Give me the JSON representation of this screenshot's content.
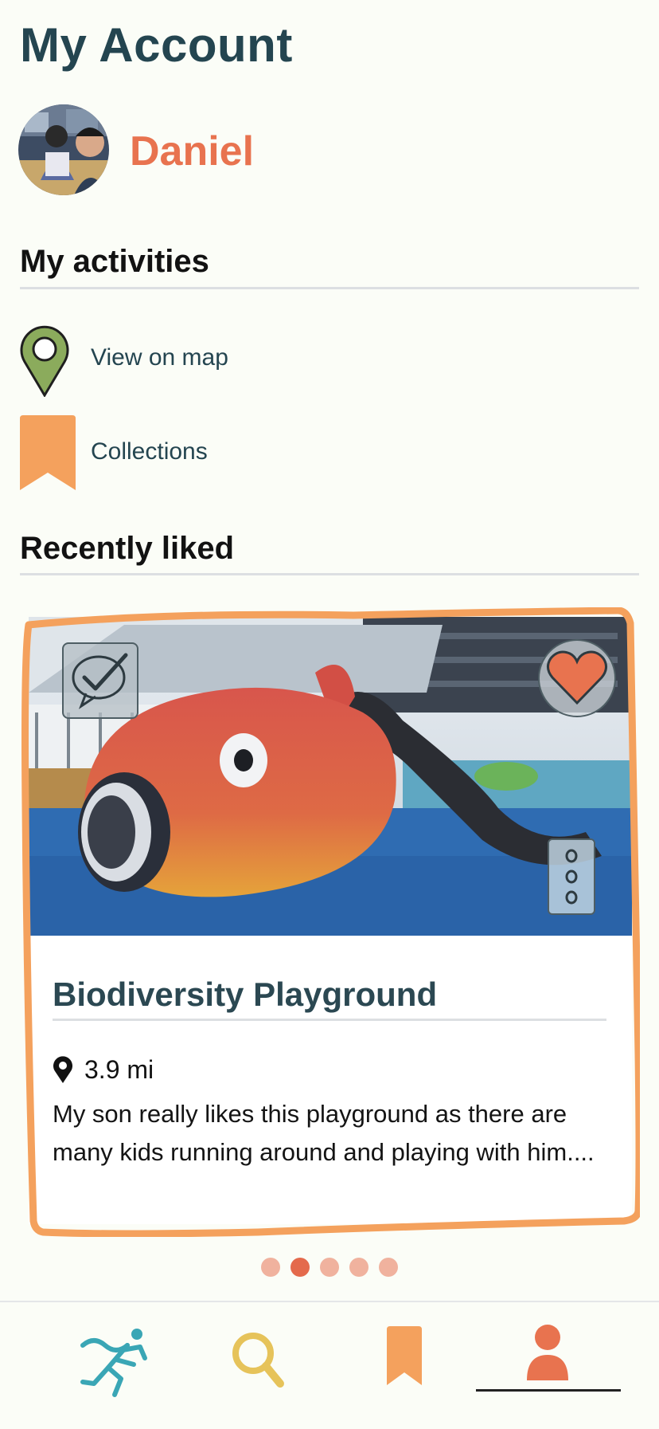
{
  "header": {
    "title": "My Account"
  },
  "profile": {
    "username": "Daniel"
  },
  "activities": {
    "heading": "My activities",
    "items": [
      {
        "label": "View on map",
        "icon": "map-pin-icon"
      },
      {
        "label": "Collections",
        "icon": "bookmark-icon"
      }
    ]
  },
  "recently_liked": {
    "heading": "Recently liked",
    "card": {
      "title": "Biodiversity Playground",
      "distance": "3.9 mi",
      "description": "My son really likes this playground as there are many kids running around and playing with him....",
      "liked": true
    },
    "pagination": {
      "total": 5,
      "active_index": 1
    }
  },
  "bottom_nav": {
    "items": [
      {
        "name": "activities",
        "icon": "running-person-icon"
      },
      {
        "name": "search",
        "icon": "search-icon"
      },
      {
        "name": "saved",
        "icon": "bookmark-icon"
      },
      {
        "name": "account",
        "icon": "person-icon",
        "active": true
      }
    ]
  },
  "colors": {
    "accent_orange": "#f4a15d",
    "username_coral": "#e8734f",
    "title_teal": "#244550",
    "pin_green": "#8bab5c",
    "nav_teal": "#3aa6b5",
    "nav_yellow": "#e6c35a"
  }
}
